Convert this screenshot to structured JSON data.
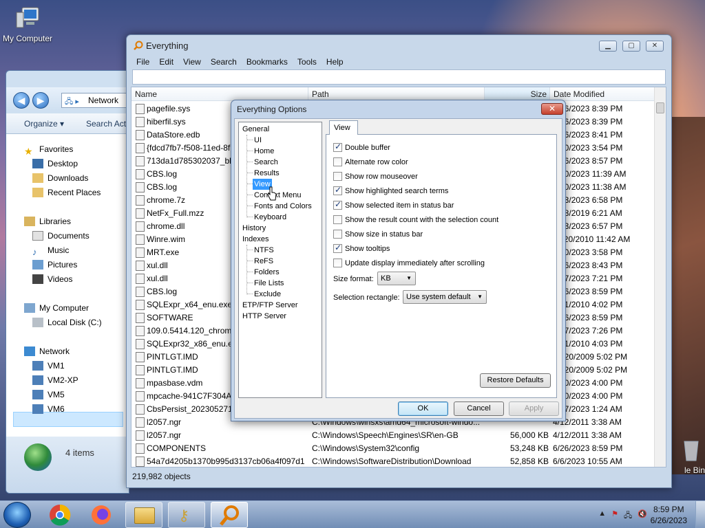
{
  "desktop": {
    "icons": [
      {
        "label": "My Computer",
        "icon": "computer-icon"
      },
      {
        "label": "le Bin",
        "icon": "recycle-bin-icon"
      }
    ]
  },
  "explorer": {
    "address": "Network",
    "toolbar": {
      "organize": "Organize ▾",
      "search_action": "Search Act"
    },
    "nav": {
      "favorites": "Favorites",
      "desktop": "Desktop",
      "downloads": "Downloads",
      "recent": "Recent Places",
      "libraries": "Libraries",
      "documents": "Documents",
      "music": "Music",
      "pictures": "Pictures",
      "videos": "Videos",
      "my_computer": "My Computer",
      "local_disk": "Local Disk (C:)",
      "network": "Network",
      "vm1": "VM1",
      "vm2": "VM2-XP",
      "vm5": "VM5",
      "vm6": "VM6"
    },
    "status": "4 items"
  },
  "everything": {
    "title": "Everything",
    "menu": [
      "File",
      "Edit",
      "View",
      "Search",
      "Bookmarks",
      "Tools",
      "Help"
    ],
    "search_value": "",
    "columns": {
      "name": "Name",
      "path": "Path",
      "size": "Size",
      "date": "Date Modified"
    },
    "rows": [
      {
        "name": "pagefile.sys",
        "path": "",
        "size": "",
        "date": "6/26/2023 8:39 PM"
      },
      {
        "name": "hiberfil.sys",
        "path": "",
        "size": "",
        "date": "6/26/2023 8:39 PM"
      },
      {
        "name": "DataStore.edb",
        "path": "",
        "size": "",
        "date": "6/26/2023 8:41 PM"
      },
      {
        "name": "{fdcd7fb7-f508-11ed-8f",
        "path": "",
        "size": "",
        "date": "5/20/2023 3:54 PM"
      },
      {
        "name": "713da1d785302037_blob",
        "path": "",
        "size": "",
        "date": "6/26/2023 8:57 PM"
      },
      {
        "name": "CBS.log",
        "path": "",
        "size": "",
        "date": "5/20/2023 11:39 AM"
      },
      {
        "name": "CBS.log",
        "path": "",
        "size": "",
        "date": "5/20/2023 11:38 AM"
      },
      {
        "name": "chrome.7z",
        "path": "",
        "size": "",
        "date": "6/23/2023 6:58 PM"
      },
      {
        "name": "NetFx_Full.mzz",
        "path": "",
        "size": "",
        "date": "6/18/2019 6:21 AM"
      },
      {
        "name": "chrome.dll",
        "path": "",
        "size": "",
        "date": "6/23/2023 6:57 PM"
      },
      {
        "name": "Winre.wim",
        "path": "",
        "size": "",
        "date": "11/20/2010 11:42 AM"
      },
      {
        "name": "MRT.exe",
        "path": "",
        "size": "",
        "date": "5/20/2023 3:58 PM"
      },
      {
        "name": "xul.dll",
        "path": "",
        "size": "",
        "date": "6/26/2023 8:43 PM"
      },
      {
        "name": "xul.dll",
        "path": "",
        "size": "",
        "date": "6/27/2023 7:21 PM"
      },
      {
        "name": "CBS.log",
        "path": "",
        "size": "",
        "date": "6/26/2023 8:59 PM"
      },
      {
        "name": "SQLExpr_x64_enu.exe",
        "path": "",
        "size": "",
        "date": "4/21/2010 4:02 PM"
      },
      {
        "name": "SOFTWARE",
        "path": "",
        "size": "",
        "date": "6/26/2023 8:59 PM"
      },
      {
        "name": "109.0.5414.120_chrome_",
        "path": "",
        "size": "",
        "date": "6/27/2023 7:26 PM"
      },
      {
        "name": "SQLExpr32_x86_enu.exe",
        "path": "",
        "size": "",
        "date": "4/21/2010 4:03 PM"
      },
      {
        "name": "PINTLGT.IMD",
        "path": "",
        "size": "",
        "date": "10/20/2009 5:02 PM"
      },
      {
        "name": "PINTLGT.IMD",
        "path": "",
        "size": "",
        "date": "10/20/2009 5:02 PM"
      },
      {
        "name": "mpasbase.vdm",
        "path": "",
        "size": "",
        "date": "5/20/2023 4:00 PM"
      },
      {
        "name": "mpcache-941C7F304A9",
        "path": "",
        "size": "",
        "date": "5/20/2023 4:00 PM"
      },
      {
        "name": "CbsPersist_20230527154",
        "path": "",
        "size": "",
        "date": "5/27/2023 1:24 AM"
      },
      {
        "name": "l2057.ngr",
        "path": "C:\\Windows\\winsxs\\amd64_microsoft-windo...",
        "size": "",
        "date": "4/12/2011 3:38 AM"
      },
      {
        "name": "l2057.ngr",
        "path": "C:\\Windows\\Speech\\Engines\\SR\\en-GB",
        "size": "56,000 KB",
        "date": "4/12/2011 3:38 AM"
      },
      {
        "name": "COMPONENTS",
        "path": "C:\\Windows\\System32\\config",
        "size": "53,248 KB",
        "date": "6/26/2023 8:59 PM"
      },
      {
        "name": "54a7d4205b1370b995d3137cb06a4f097d17...",
        "path": "C:\\Windows\\SoftwareDistribution\\Download",
        "size": "52,858 KB",
        "date": "6/6/2023 10:55 AM"
      }
    ],
    "status": "219,982 objects"
  },
  "options": {
    "title": "Everything Options",
    "close": "✕",
    "tree": {
      "general": "General",
      "ui": "UI",
      "home": "Home",
      "search": "Search",
      "results": "Results",
      "view": "View",
      "context_menu": "Context Menu",
      "fonts": "Fonts and Colors",
      "keyboard": "Keyboard",
      "history": "History",
      "indexes": "Indexes",
      "ntfs": "NTFS",
      "refs": "ReFS",
      "folders": "Folders",
      "file_lists": "File Lists",
      "exclude": "Exclude",
      "etp": "ETP/FTP Server",
      "http": "HTTP Server"
    },
    "tab": "View",
    "checkboxes": [
      {
        "label": "Double buffer",
        "checked": true
      },
      {
        "label": "Alternate row color",
        "checked": false
      },
      {
        "label": "Show row mouseover",
        "checked": false
      },
      {
        "label": "Show highlighted search terms",
        "checked": true
      },
      {
        "label": "Show selected item in status bar",
        "checked": true
      },
      {
        "label": "Show the result count with the selection count",
        "checked": false
      },
      {
        "label": "Show size in status bar",
        "checked": false
      },
      {
        "label": "Show tooltips",
        "checked": true
      },
      {
        "label": "Update display immediately after scrolling",
        "checked": false
      }
    ],
    "size_format_label": "Size format:",
    "size_format_value": "KB",
    "selection_rect_label": "Selection rectangle:",
    "selection_rect_value": "Use system default",
    "restore": "Restore Defaults",
    "ok": "OK",
    "cancel": "Cancel",
    "apply": "Apply"
  },
  "taskbar": {
    "time": "8:59 PM",
    "date": "6/26/2023"
  },
  "colors": {
    "selection": "#3399ff",
    "title_close": "#c4402c"
  }
}
